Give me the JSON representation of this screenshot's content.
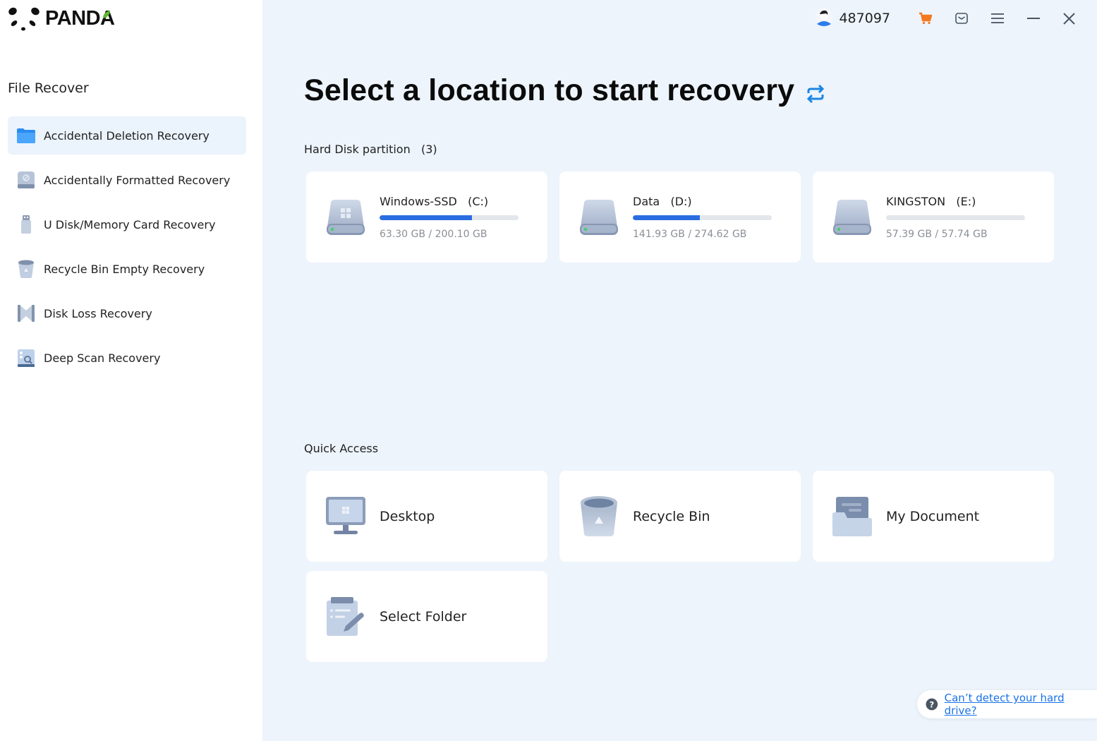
{
  "app": {
    "brand": "PANDA"
  },
  "sidebar": {
    "section_title": "File Recover",
    "items": [
      {
        "label": "Accidental Deletion Recovery",
        "icon": "folder-icon",
        "active": true
      },
      {
        "label": "Accidentally Formatted Recovery",
        "icon": "formatted-disk-icon",
        "active": false
      },
      {
        "label": "U Disk/Memory Card Recovery",
        "icon": "usb-drive-icon",
        "active": false
      },
      {
        "label": "Recycle Bin Empty Recovery",
        "icon": "recycle-bin-icon",
        "active": false
      },
      {
        "label": "Disk Loss Recovery",
        "icon": "disk-loss-icon",
        "active": false
      },
      {
        "label": "Deep Scan Recovery",
        "icon": "deep-scan-icon",
        "active": false
      }
    ]
  },
  "topbar": {
    "user_id": "487097",
    "icons": [
      "avatar",
      "cart-icon",
      "message-icon",
      "menu-icon",
      "minimize-icon",
      "close-icon"
    ],
    "cart_color": "#f5781f"
  },
  "main": {
    "title": "Select a location to start recovery",
    "partitions_label": "Hard Disk partition",
    "partitions_count": "(3)",
    "partitions": [
      {
        "name": "Windows-SSD",
        "letter": "(C:)",
        "used": "63.30 GB",
        "total": "200.10 GB",
        "size_text": "63.30 GB / 200.10 GB",
        "fill": 0.6652,
        "icon": "windows-drive-icon"
      },
      {
        "name": "Data",
        "letter": "(D:)",
        "used": "141.93 GB",
        "total": "274.62 GB",
        "size_text": "141.93 GB / 274.62 GB",
        "fill": 0.4832,
        "icon": "hard-drive-icon"
      },
      {
        "name": "KINGSTON",
        "letter": "(E:)",
        "used": "57.39 GB",
        "total": "57.74 GB",
        "size_text": "57.39 GB / 57.74 GB",
        "fill": 0.0,
        "icon": "hard-drive-icon"
      }
    ],
    "quick_access_label": "Quick Access",
    "quick_access": [
      {
        "label": "Desktop",
        "icon": "desktop-icon"
      },
      {
        "label": "Recycle Bin",
        "icon": "recycle-bin-icon"
      },
      {
        "label": "My Document",
        "icon": "document-folder-icon"
      },
      {
        "label": "Select Folder",
        "icon": "select-folder-icon"
      }
    ],
    "accent_color": "#2b6de0"
  },
  "help": {
    "link_text": "Can’t detect your hard drive?"
  }
}
